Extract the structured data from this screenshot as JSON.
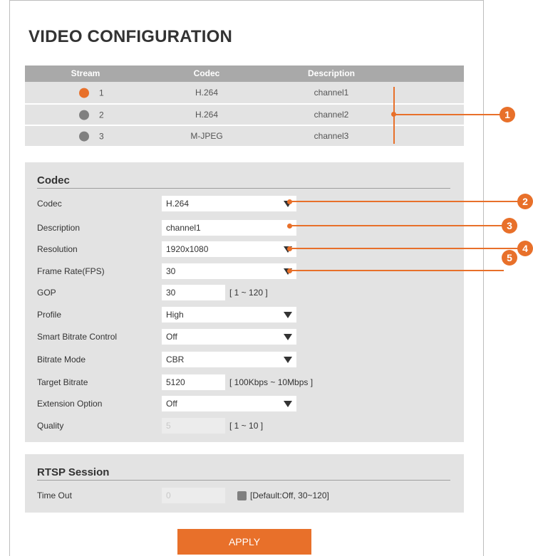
{
  "page": {
    "title": "VIDEO CONFIGURATION"
  },
  "stream_table": {
    "headers": {
      "stream": "Stream",
      "codec": "Codec",
      "description": "Description"
    },
    "rows": [
      {
        "stream": "1",
        "codec": "H.264",
        "description": "channel1",
        "selected": true
      },
      {
        "stream": "2",
        "codec": "H.264",
        "description": "channel2",
        "selected": false
      },
      {
        "stream": "3",
        "codec": "M-JPEG",
        "description": "channel3",
        "selected": false
      }
    ]
  },
  "codec_panel": {
    "title": "Codec",
    "codec": {
      "label": "Codec",
      "value": "H.264"
    },
    "description": {
      "label": "Description",
      "value": "channel1"
    },
    "resolution": {
      "label": "Resolution",
      "value": "1920x1080"
    },
    "frame_rate": {
      "label": "Frame Rate(FPS)",
      "value": "30"
    },
    "gop": {
      "label": "GOP",
      "value": "30",
      "hint": "[ 1 ~ 120 ]"
    },
    "profile": {
      "label": "Profile",
      "value": "High"
    },
    "smart_bitrate": {
      "label": "Smart Bitrate Control",
      "value": "Off"
    },
    "bitrate_mode": {
      "label": "Bitrate Mode",
      "value": "CBR"
    },
    "target_bitrate": {
      "label": "Target Bitrate",
      "value": "5120",
      "hint": "[ 100Kbps ~ 10Mbps ]"
    },
    "extension_option": {
      "label": "Extension Option",
      "value": "Off"
    },
    "quality": {
      "label": "Quality",
      "value": "5",
      "hint": "[ 1 ~ 10 ]"
    }
  },
  "rtsp_panel": {
    "title": "RTSP Session",
    "time_out": {
      "label": "Time Out",
      "value": "0",
      "hint": "[Default:Off, 30~120]"
    }
  },
  "apply_label": "APPLY",
  "callouts": [
    "1",
    "2",
    "3",
    "4",
    "5"
  ],
  "colors": {
    "accent": "#e8702a",
    "panel_bg": "#e3e3e3",
    "table_header": "#a9a9a9"
  }
}
